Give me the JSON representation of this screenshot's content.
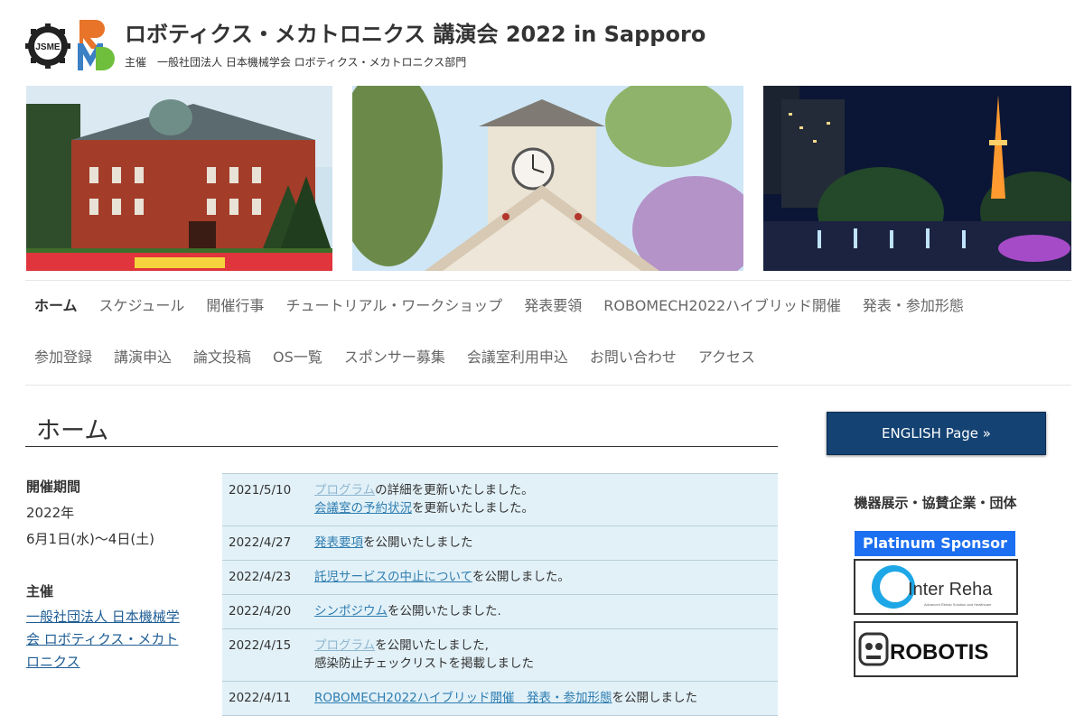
{
  "header": {
    "title": "ロボティクス・メカトロニクス 講演会 2022 in Sapporo",
    "subtitle": "主催　一般社団法人 日本機械学会 ロボティクス・メカトロニクス部門",
    "logo_jsme_text": "JSME"
  },
  "nav": {
    "row1": [
      "ホーム",
      "スケジュール",
      "開催行事",
      "チュートリアル・ワークショップ",
      "発表要領",
      "ROBOMECH2022ハイブリッド開催",
      "発表・参加形態"
    ],
    "row2": [
      "参加登録",
      "講演申込",
      "論文投稿",
      "OS一覧",
      "スポンサー募集",
      "会議室利用申込",
      "お問い合わせ",
      "アクセス"
    ],
    "active": "ホーム"
  },
  "page_title": "ホーム",
  "info": {
    "period_label": "開催期間",
    "period_year": "2022年",
    "period_dates": "6月1日(水)〜4日(土)",
    "host_label": "主催",
    "host_link": "一般社団法人 日本機械学会 ロボティクス・メカトロニクス"
  },
  "news": [
    {
      "date": "2021/5/10",
      "l1_link": "プログラム",
      "l1_text": "の詳細を更新いたしました。",
      "l2_link": "会議室の予約状況",
      "l2_text": "を更新いたしました。"
    },
    {
      "date": "2022/4/27",
      "l1_link": "発表要項",
      "l1_text": "を公開いたしました"
    },
    {
      "date": "2022/4/23",
      "l1_link": "託児サービスの中止について",
      "l1_text": "を公開しました。"
    },
    {
      "date": "2022/4/20",
      "l1_link": "シンポジウム",
      "l1_text": "を公開いたしました."
    },
    {
      "date": "2022/4/15",
      "l1_link": "プログラム",
      "l1_text": "を公開いたしました,",
      "l2_plain": "感染防止チェックリストを掲載しました"
    },
    {
      "date": "2022/4/11",
      "l1_link": "ROBOMECH2022ハイブリッド開催　発表・参加形態",
      "l1_text": "を公開しました"
    }
  ],
  "sidebar": {
    "english_button": "ENGLISH Page »",
    "sponsors_heading": "機器展示・協賛企業・団体",
    "platinum_label": "Platinum Sponsor",
    "sponsor1": "Inter Reha",
    "sponsor1_tagline": "Advanced Rehab Solution and Healthcare",
    "sponsor2": "ROBOTIS"
  },
  "colors": {
    "nav_text": "#666666",
    "link": "#2f7db0",
    "news_bg": "#e2f1f8",
    "english_btn": "#134273",
    "platinum": "#1c6ff0"
  }
}
